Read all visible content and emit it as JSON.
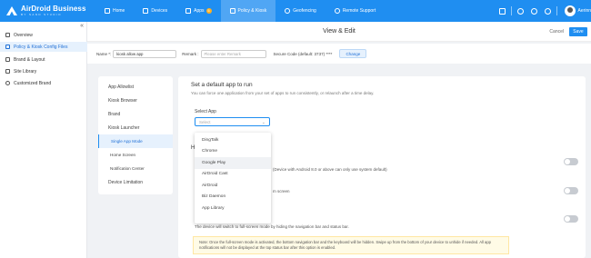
{
  "app": {
    "logo_title": "AirDroid Business",
    "logo_subtitle": "BY SAND STUDIO",
    "accent_color": "#1f8ef1"
  },
  "topnav": {
    "items": [
      {
        "label": "Home",
        "icon": "home-icon"
      },
      {
        "label": "Devices",
        "icon": "device-icon"
      },
      {
        "label": "Apps",
        "icon": "apps-icon",
        "badge": "5"
      },
      {
        "label": "Policy & Kiosk",
        "icon": "policy-icon",
        "active": true
      },
      {
        "label": "Geofencing",
        "icon": "geofence-icon"
      },
      {
        "label": "Remote Support",
        "icon": "remote-support-icon"
      }
    ],
    "user_name": "Aerinn"
  },
  "sidebar": {
    "collapse_label": "«",
    "items": [
      {
        "label": "Overview",
        "icon": "overview-icon"
      },
      {
        "label": "Policy & Kiosk Config Files",
        "icon": "config-icon",
        "active": true
      },
      {
        "label": "Brand & Layout",
        "icon": "brand-icon"
      },
      {
        "label": "Site Library",
        "icon": "site-library-icon"
      },
      {
        "label": "Customized Brand",
        "icon": "customized-brand-icon"
      }
    ]
  },
  "header": {
    "title": "View & Edit",
    "cancel_label": "Cancel",
    "save_label": "Save"
  },
  "form": {
    "name_label": "Name *:",
    "name_value": "kiosk allow app",
    "remark_label": "Remark :",
    "remark_placeholder": "Please enter Remark",
    "secure_code_label": "Secure Code (default: 3737) ****",
    "change_label": "Change"
  },
  "config_menu": {
    "items": [
      {
        "label": "App Allowlist"
      },
      {
        "label": "Kiosk Browser"
      },
      {
        "label": "Brand"
      },
      {
        "label": "Kiosk Launcher"
      },
      {
        "label": "Single App Mode",
        "active": true
      },
      {
        "label": "Home Screen"
      },
      {
        "label": "Notification Center"
      },
      {
        "label": "Device Limitation"
      }
    ]
  },
  "content": {
    "section_title": "Set a default app to run",
    "section_desc": "You can force one application from your set of apps to run consistently, or relaunch after a time delay.",
    "select_label": "Select App",
    "select_placeholder": "Select",
    "hidden_heading": "H",
    "row1_text": "(Device with Android 8.0 or above can only use system default)",
    "row2_text": "m screen",
    "row3_text": "The device will switch to full-screen mode by hiding the navigation bar and status bar.",
    "note_text": "Note: Once the full-screen mode is activated, the bottom navigation bar and the keyboard will be hidden. Swipe up from the bottom of your device to unhide if needed. All app notifications will not be displayed at the top status bar after this option is enabled."
  },
  "dropdown": {
    "options": [
      "DingTalk",
      "Chrome",
      "Google Play",
      "AirDroid Cast",
      "AirDroid",
      "Biz Daemon",
      "App Library"
    ],
    "hover_index": 2
  }
}
